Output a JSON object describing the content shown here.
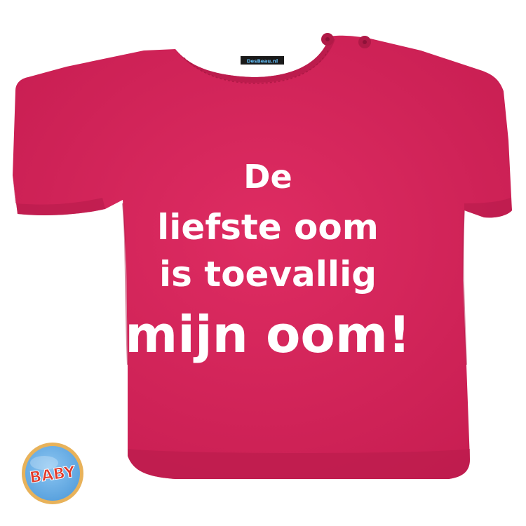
{
  "product": {
    "shirt_color": "#D8245A",
    "shirt_shadow_color": "#B81B4B",
    "print_color": "#FFFFFF",
    "print_lines": [
      "De",
      "liefste oom",
      "is toevallig",
      "mijn oom!"
    ],
    "neck_label_text": "DesBeau.nl"
  },
  "badge": {
    "text": "BABY",
    "fill_color": "#6FB3E8",
    "ring_color": "#E8B25A",
    "text_color": "#E03A2A"
  }
}
